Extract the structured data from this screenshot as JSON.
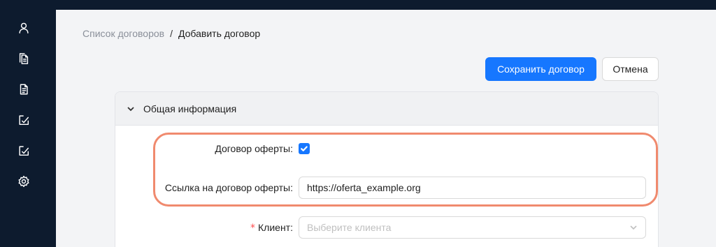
{
  "sidebar": {
    "icons": [
      "user-icon",
      "copy-documents-icon",
      "document-list-icon",
      "edit-square-icon",
      "edit-square-icon",
      "settings-gear-icon"
    ]
  },
  "breadcrumb": {
    "parent": "Список договоров",
    "separator": "/",
    "current": "Добавить договор"
  },
  "actions": {
    "save_label": "Сохранить договор",
    "cancel_label": "Отмена"
  },
  "section": {
    "title": "Общая информация",
    "expanded": true
  },
  "form": {
    "offer_contract": {
      "label": "Договор оферты",
      "colon": ":",
      "checked": true
    },
    "offer_link": {
      "label": "Ссылка на договор оферты",
      "colon": ":",
      "value": "https://oferta_example.org"
    },
    "client": {
      "required_mark": "*",
      "label": "Клиент",
      "colon": ":",
      "placeholder": "Выберите клиента"
    }
  },
  "colors": {
    "primary": "#1677ff",
    "sidebar_bg": "#0d1b2e",
    "highlight": "#f08a6e",
    "required": "#ff4d4f"
  }
}
